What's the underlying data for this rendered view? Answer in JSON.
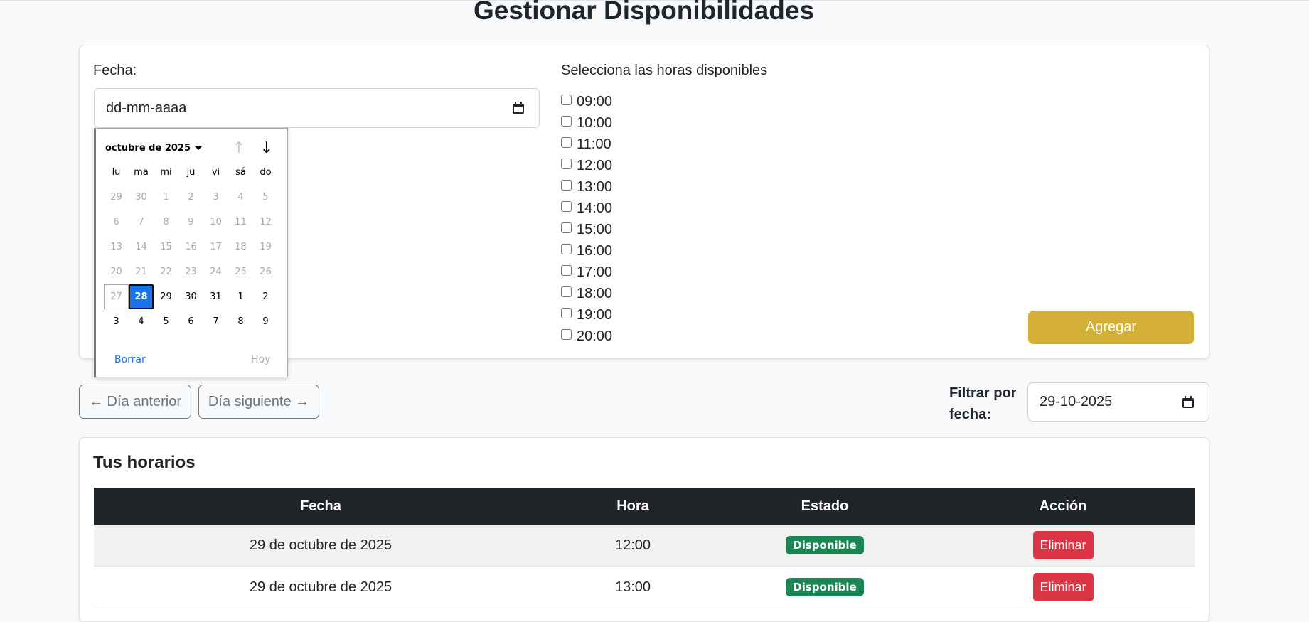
{
  "page": {
    "title": "Gestionar Disponibilidades"
  },
  "form": {
    "date_label": "Fecha:",
    "date_placeholder": "dd-mm-aaaa",
    "hours_label": "Selecciona las horas disponibles",
    "hours": [
      "09:00",
      "10:00",
      "11:00",
      "12:00",
      "13:00",
      "14:00",
      "15:00",
      "16:00",
      "17:00",
      "18:00",
      "19:00",
      "20:00"
    ],
    "add_button": "Agregar",
    "add_button_color": "#d4af37"
  },
  "calendar": {
    "month_label": "octubre de 2025",
    "weekdays": [
      "lu",
      "ma",
      "mi",
      "ju",
      "vi",
      "sá",
      "do"
    ],
    "weeks": [
      [
        "29",
        "30",
        "1",
        "2",
        "3",
        "4",
        "5"
      ],
      [
        "6",
        "7",
        "8",
        "9",
        "10",
        "11",
        "12"
      ],
      [
        "13",
        "14",
        "15",
        "16",
        "17",
        "18",
        "19"
      ],
      [
        "20",
        "21",
        "22",
        "23",
        "24",
        "25",
        "26"
      ],
      [
        "27",
        "28",
        "29",
        "30",
        "31",
        "1",
        "2"
      ],
      [
        "3",
        "4",
        "5",
        "6",
        "7",
        "8",
        "9"
      ]
    ],
    "selected_day": "28",
    "today_day": "27",
    "clear_label": "Borrar",
    "today_label": "Hoy"
  },
  "nav": {
    "prev_label": "← Día anterior",
    "next_label": "Día siguiente →",
    "filter_label": "Filtrar por fecha:",
    "filter_value": "29-10-2025"
  },
  "schedule": {
    "title": "Tus horarios",
    "headers": {
      "date": "Fecha",
      "hour": "Hora",
      "status": "Estado",
      "action": "Acción"
    },
    "rows": [
      {
        "date": "29 de octubre de 2025",
        "hour": "12:00",
        "status": "Disponible",
        "action": "Eliminar"
      },
      {
        "date": "29 de octubre de 2025",
        "hour": "13:00",
        "status": "Disponible",
        "action": "Eliminar"
      }
    ],
    "status_color": "#198754",
    "delete_color": "#dc3545"
  }
}
